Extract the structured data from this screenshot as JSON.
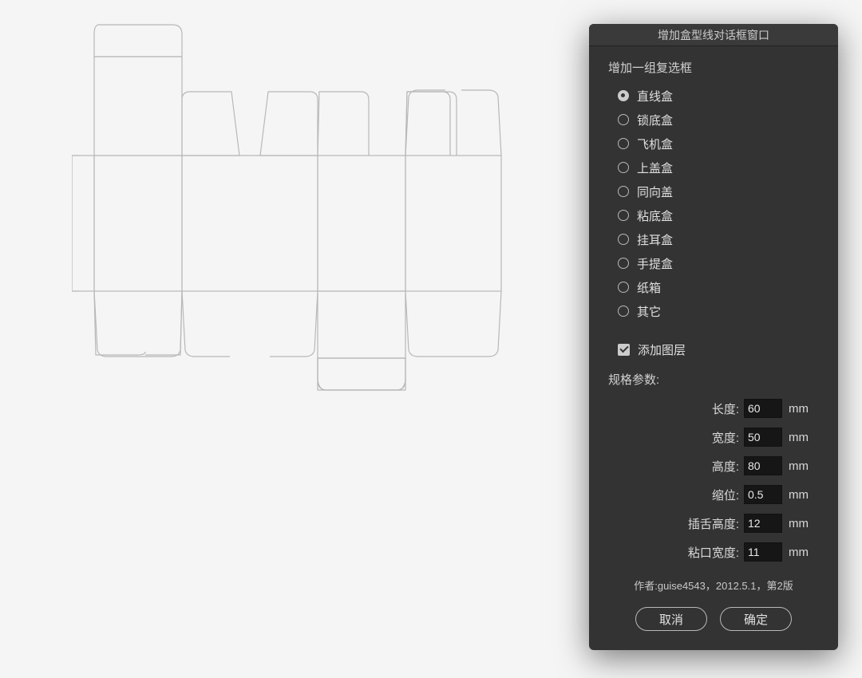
{
  "dialog": {
    "title": "增加盒型线对话框窗口",
    "group_label": "增加一组复选框",
    "options": [
      {
        "label": "直线盒",
        "selected": true
      },
      {
        "label": "锁底盒",
        "selected": false
      },
      {
        "label": "飞机盒",
        "selected": false
      },
      {
        "label": "上盖盒",
        "selected": false
      },
      {
        "label": "同向盖",
        "selected": false
      },
      {
        "label": "粘底盒",
        "selected": false
      },
      {
        "label": "挂耳盒",
        "selected": false
      },
      {
        "label": "手提盒",
        "selected": false
      },
      {
        "label": "纸箱",
        "selected": false
      },
      {
        "label": "其它",
        "selected": false
      }
    ],
    "checkbox": {
      "label": "添加图层",
      "checked": true
    },
    "params_label": "规格参数:",
    "params": [
      {
        "name": "长度:",
        "value": "60",
        "unit": "mm"
      },
      {
        "name": "宽度:",
        "value": "50",
        "unit": "mm"
      },
      {
        "name": "高度:",
        "value": "80",
        "unit": "mm"
      },
      {
        "name": "缩位:",
        "value": "0.5",
        "unit": "mm"
      },
      {
        "name": "插舌高度:",
        "value": "12",
        "unit": "mm"
      },
      {
        "name": "粘口宽度:",
        "value": "11",
        "unit": "mm"
      }
    ],
    "author_line": "作者:guise4543，2012.5.1，第2版",
    "cancel_label": "取消",
    "confirm_label": "确定"
  },
  "box_template": {
    "type": "直线盒",
    "outline_color": "#b8b8b8",
    "fold_color": "#cccccc"
  }
}
